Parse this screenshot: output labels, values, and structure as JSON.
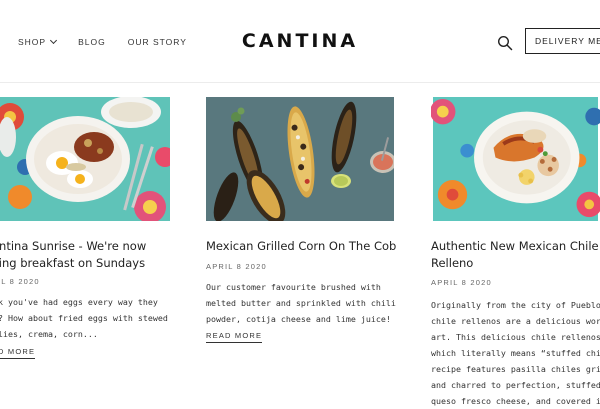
{
  "header": {
    "nav": {
      "shop": "SHOP",
      "blog": "BLOG",
      "our_story": "OUR STORY"
    },
    "logo": "CANTINA",
    "delivery_button": "DELIVERY MENU"
  },
  "posts": [
    {
      "title_lines": [
        "antina Sunrise - We're now",
        "ving breakfast on Sundays"
      ],
      "date": "IL 8 2020",
      "excerpt_lines": [
        "k you've had eggs every way they",
        "? How about fried eggs with stewed",
        "lies, crema, corn..."
      ],
      "read_more": "D MORE"
    },
    {
      "title_lines": [
        "Mexican Grilled Corn On The Cob"
      ],
      "date": "APRIL 8 2020",
      "excerpt_lines": [
        "Our customer favourite brushed with",
        "melted butter and sprinkled with chili",
        "powder, cotija cheese and lime juice!"
      ],
      "read_more": "READ MORE"
    },
    {
      "title_lines": [
        "Authentic New Mexican Chile",
        "Relleno"
      ],
      "date": "APRIL 8 2020",
      "excerpt_lines": [
        "Originally from the city of Pueblo,",
        "chile rellenos are a delicious work o",
        "art. This delicious chile rellenos -",
        "which literally means “stuffed chile”",
        "recipe features pasilla chiles grille",
        "and charred to perfection, stuffed wi",
        "queso fresco cheese, and covered in a"
      ],
      "read_more": ""
    }
  ]
}
